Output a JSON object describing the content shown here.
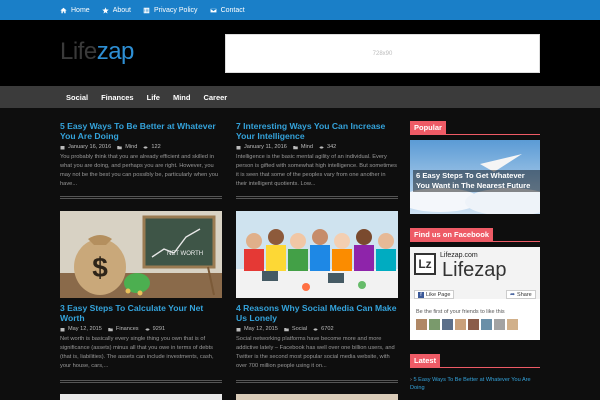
{
  "topnav": [
    {
      "label": "Home",
      "icon": "home-icon"
    },
    {
      "label": "About",
      "icon": "star-icon"
    },
    {
      "label": "Privacy Policy",
      "icon": "checklist-icon"
    },
    {
      "label": "Contact",
      "icon": "envelope-icon"
    }
  ],
  "site": {
    "logo_part1": "Life",
    "logo_part2": "zap",
    "ad_text": "728x90"
  },
  "mainnav": [
    "Social",
    "Finances",
    "Life",
    "Mind",
    "Career"
  ],
  "posts": [
    {
      "title": "5 Easy Ways To Be Better at Whatever You Are Doing",
      "date": "January 16, 2016",
      "category": "Mind",
      "comments": "122",
      "excerpt": "You probably think that you are already efficient and skilled in what you are doing, and perhaps you are right. However, you may not be the best you can possibly be, particularly when you have..."
    },
    {
      "title": "7 Interesting Ways You Can Increase Your Intelligence",
      "date": "January 11, 2016",
      "category": "Mind",
      "comments": "342",
      "excerpt": "Intelligence is the basic mental agility of an individual. Every person is gifted with somewhat high intelligence. But sometimes it is seen that some of the peoples vary from one another in their intelligent quotients. Low..."
    },
    {
      "title": "3 Easy Steps To Calculate Your Net Worth",
      "date": "May 12, 2015",
      "category": "Finances",
      "comments": "9291",
      "excerpt": "Net worth is basically every single thing you own that is of significance (assets) minus all that you owe in terms of debts (that is, liabilities). The assets can include investments, cash, your house, cars,..."
    },
    {
      "title": "4 Reasons Why Social Media Can Make Us Lonely",
      "date": "May 12, 2015",
      "category": "Social",
      "comments": "6702",
      "excerpt": "Social networking platforms have become more and more addictive lately – Facebook has well over one billion users, and Twitter is the second most popular social media website, with over 700 million people using it on..."
    }
  ],
  "thumb_texts": {
    "net_worth": "NET WORTH"
  },
  "sidebar": {
    "popular_title": "Popular",
    "popular_caption": "6 Easy Steps To Get Whatever You Want in The Nearest Future",
    "facebook_title": "Find us on Facebook",
    "fb_page": "Lifezap.com",
    "fb_logo_lz": "Lz",
    "fb_logo_text": "Lifezap",
    "fb_like": "Like Page",
    "fb_share": "Share",
    "fb_friends": "Be the first of your friends to like this",
    "latest_title": "Latest",
    "latest_item": "5 Easy Ways To Be Better at Whatever You Are Doing"
  },
  "colors": {
    "topbar": "#1a7fc8",
    "accent": "#ee5b66",
    "link": "#34a3db"
  }
}
